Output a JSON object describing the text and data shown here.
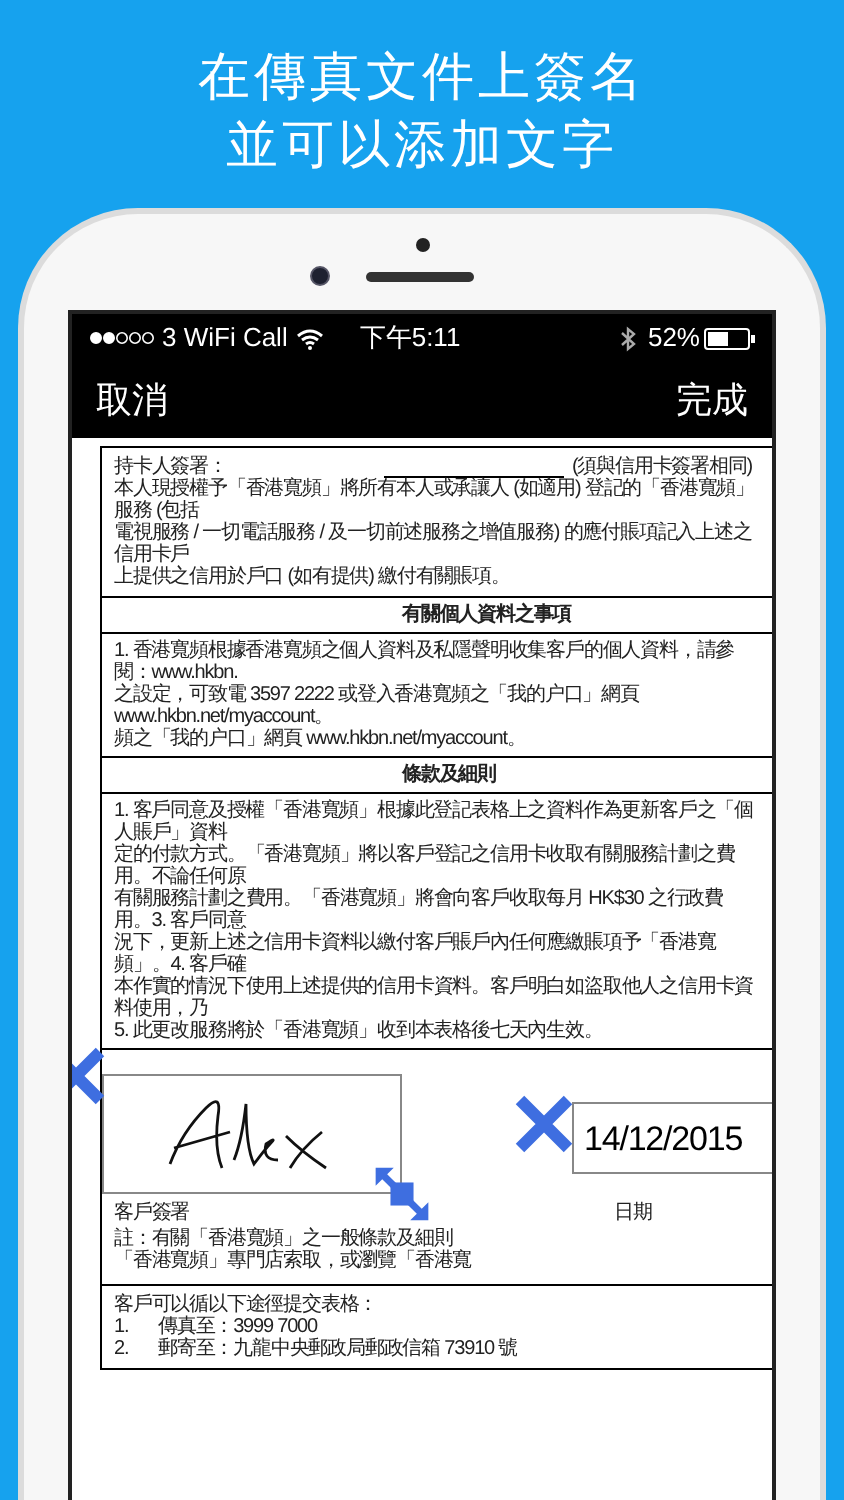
{
  "headline": [
    "在傳真文件上簽名",
    "並可以添加文字"
  ],
  "status_bar": {
    "carrier": "3 WiFi Call",
    "time": "下午5:11",
    "battery": "52%"
  },
  "nav": {
    "cancel": "取消",
    "done": "完成"
  },
  "document": {
    "cardholder_signature_label": "持卡人簽署：",
    "signature_note": "(須與信用卡簽署相同)",
    "authorization": [
      "本人現授權予「香港寬頻」將所有本人或承讓人 (如適用) 登記的「香港寬頻」服務 (包括",
      "電視服務 / 一切電話服務 / 及一切前述服務之增值服務) 的應付賬項記入上述之信用卡戶",
      "上提供之信用於戶口 (如有提供) 繳付有關賬項。"
    ],
    "sections": [
      {
        "heading": "有關個人資料之事項",
        "lines": [
          "1. 香港寬頻根據香港寬頻之個人資料及私隱聲明收集客戶的個人資料，請參閱：www.hkbn.",
          "之設定，可致電 3597 2222 或登入香港寬頻之「我的户口」網頁 www.hkbn.net/myaccount。",
          "頻之「我的户口」網頁 www.hkbn.net/myaccount。"
        ]
      },
      {
        "heading": "條款及細則",
        "lines": [
          "1. 客戶同意及授權「香港寬頻」根據此登記表格上之資料作為更新客戶之「個人賬戶」資料",
          "定的付款方式。「香港寬頻」將以客戶登記之信用卡收取有關服務計劃之費用。不論任何原",
          "有關服務計劃之費用。「香港寬頻」將會向客戶收取每月 HK$30 之行政費用。3. 客戶同意",
          "況下，更新上述之信用卡資料以繳付客戶賬戶內任何應繳賬項予「香港寬頻」。4. 客戶確",
          "本作實的情況下使用上述提供的信用卡資料。客戶明白如盜取他人之信用卡資料使用，乃",
          "5. 此更改服務將於「香港寬頻」收到本表格後七天內生效。"
        ]
      }
    ],
    "customer_signature_label": "客戶簽署",
    "date_label": "日期",
    "note_start": "註：有關「香港寬頻」之一般條款及細則",
    "note_end": "「香港寬頻」專門店索取，或瀏覽「香港寬",
    "submission": {
      "intro": "客戶可以循以下途徑提交表格：",
      "items": [
        {
          "number": "1.",
          "text": "傳真至：3999 7000"
        },
        {
          "number": "2.",
          "text": "郵寄至：九龍中央郵政局郵政信箱 73910 號"
        }
      ]
    }
  },
  "date_stamp": "14/12/2015"
}
